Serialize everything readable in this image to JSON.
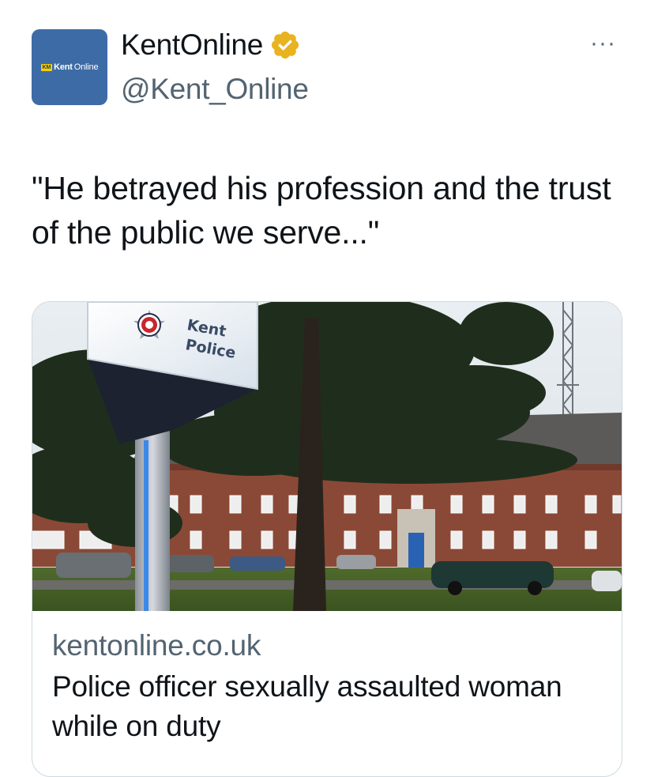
{
  "tweet": {
    "author": {
      "display_name": "KentOnline",
      "handle": "@Kent_Online",
      "verified": true,
      "verified_icon": "verified-badge-icon",
      "verified_color": "#e8b320",
      "avatar": {
        "brand_color": "#3d6ba6",
        "badge_text": "KM",
        "logo_text_bold": "Kent",
        "logo_text_regular": "Online"
      }
    },
    "more_label": "···",
    "text": "\"He betrayed his profession and the trust of the public we serve...\""
  },
  "link_card": {
    "image": {
      "sign_line1": "Kent",
      "sign_line2": "Police"
    },
    "domain": "kentonline.co.uk",
    "title": "Police officer sexually assaulted woman while on duty"
  }
}
